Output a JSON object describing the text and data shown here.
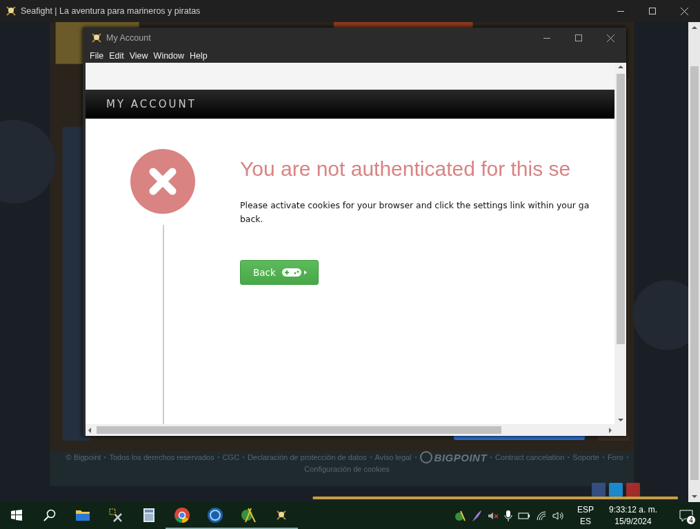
{
  "window": {
    "title": "Seafight | La aventura para marineros y piratas"
  },
  "game_page": {
    "footer_links": [
      "© Bigpoint",
      "Todos los derechos reservados",
      "CGC",
      "Declaración de protección de datos",
      "Aviso legal"
    ],
    "logo_text": "BIGPOINT",
    "footer_links_after": [
      "Contract cancelation",
      "Soporte",
      "Foro",
      "Configuración de cookies"
    ]
  },
  "dialog": {
    "title": "My Account",
    "menu": [
      "File",
      "Edit",
      "View",
      "Window",
      "Help"
    ],
    "header": "MY ACCOUNT",
    "heading": "You are not authenticated for this se",
    "message_lines": [
      "Please activate cookies for your browser and click the settings link within your ga",
      "back."
    ],
    "button": "Back"
  },
  "taskbar": {
    "apps": [
      {
        "kind": "folder",
        "running": false
      },
      {
        "kind": "tools",
        "running": false
      },
      {
        "kind": "calculator",
        "running": false
      },
      {
        "kind": "chrome",
        "running": true
      },
      {
        "kind": "circle",
        "running": true
      },
      {
        "kind": "globe",
        "running": true
      },
      {
        "kind": "skull",
        "running": true
      }
    ],
    "language": "ESP",
    "layout": "ES",
    "time": "9:33:12 a. m.",
    "date": "15/9/2024",
    "notifications": "4"
  }
}
